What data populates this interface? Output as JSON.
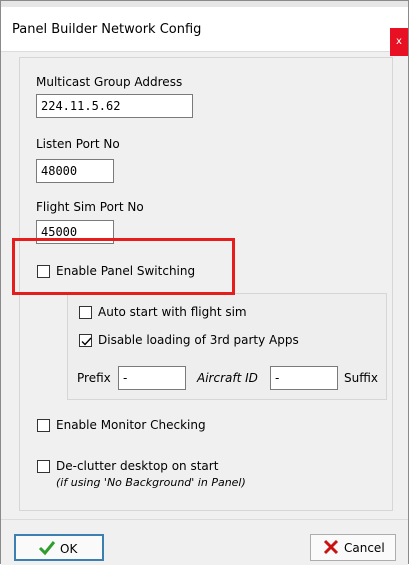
{
  "window": {
    "title": "Panel Builder Network Config",
    "close_glyph": "x"
  },
  "network": {
    "multicast_label": "Multicast Group Address",
    "multicast_value": "224.11.5.62",
    "listen_label": "Listen Port No",
    "listen_value": "48000",
    "flightsim_label": "Flight Sim Port No",
    "flightsim_value": "45000"
  },
  "panel_switching": {
    "label": "Enable Panel Switching",
    "checked": false,
    "auto_start_label": "Auto start with flight sim",
    "auto_start_checked": false,
    "disable_third_party_label": "Disable loading of 3rd party Apps",
    "disable_third_party_checked": true,
    "prefix_label": "Prefix",
    "prefix_value": "-",
    "aircraft_id_label": "Aircraft ID",
    "aircraft_id_value": "-",
    "suffix_label": "Suffix"
  },
  "monitor": {
    "label": "Enable Monitor Checking",
    "checked": false
  },
  "declutter": {
    "label": "De-clutter desktop on start",
    "note": "(if using 'No Background' in Panel)",
    "checked": false
  },
  "footer": {
    "ok_label": "OK",
    "cancel_label": "Cancel"
  },
  "colors": {
    "highlight": "#e51d1d",
    "ok_check": "#2f9e2f",
    "cancel_x": "#cc1111",
    "close_bg": "#e81123"
  },
  "icons": {
    "ok": "check-icon",
    "cancel": "x-icon"
  }
}
